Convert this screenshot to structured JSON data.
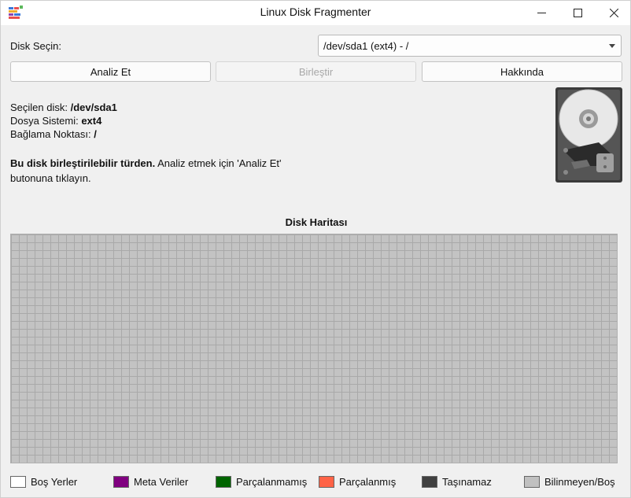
{
  "window": {
    "title": "Linux Disk Fragmenter",
    "controls": {
      "minimize": "minimize",
      "maximize": "maximize",
      "close": "close"
    }
  },
  "disk_select": {
    "label": "Disk Seçin:",
    "selected": "/dev/sda1 (ext4) - /"
  },
  "buttons": {
    "analyze": "Analiz Et",
    "defragment": "Birleştir",
    "about": "Hakkında"
  },
  "info": {
    "disk_label": "Seçilen disk:",
    "disk_value": "/dev/sda1",
    "fs_label": "Dosya Sistemi:",
    "fs_value": "ext4",
    "mount_label": "Bağlama Noktası:",
    "mount_value": "/"
  },
  "message": {
    "bold": "Bu disk birleştirilebilir türden.",
    "rest": "Analiz etmek için 'Analiz Et' butonuna tıklayın."
  },
  "disk_map": {
    "title": "Disk Haritası"
  },
  "legend": [
    {
      "label": "Boş Yerler",
      "color": "#ffffff"
    },
    {
      "label": "Meta Veriler",
      "color": "#800080"
    },
    {
      "label": "Parçalanmamış",
      "color": "#006400"
    },
    {
      "label": "Parçalanmış",
      "color": "#ff6347"
    },
    {
      "label": "Taşınamaz",
      "color": "#404040"
    },
    {
      "label": "Bilinmeyen/Boş",
      "color": "#c0c0c0"
    }
  ],
  "icons": {
    "app": "app-icon",
    "hdd": "hard-disk-icon"
  }
}
